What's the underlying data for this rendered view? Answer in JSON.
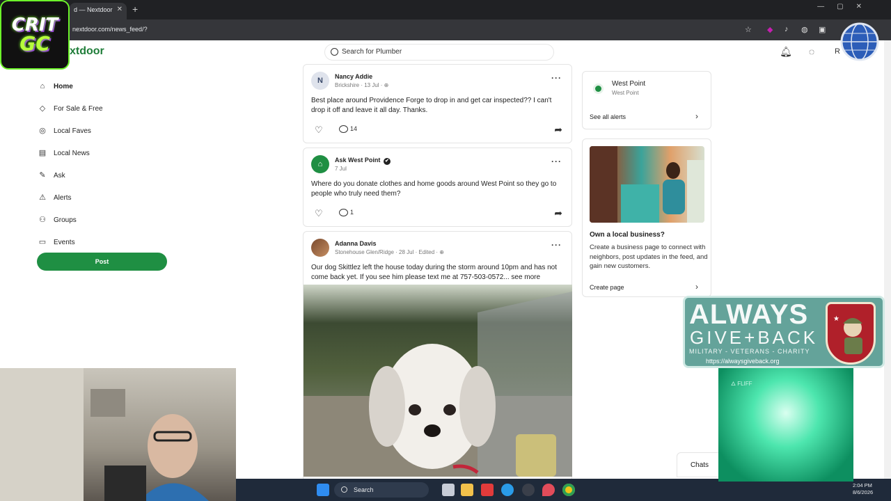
{
  "browser": {
    "tab_title": "d — Nextdoor",
    "tab_close": "✕",
    "new_tab": "+",
    "url": "nextdoor.com/news_feed/?"
  },
  "overlay": {
    "logo_line1": "CRIT",
    "logo_line2": "GC",
    "banner_big": "ALWAYS",
    "banner_small": "GIVE+BACK",
    "banner_sub": "MILITARY - VETERANS - CHARITY",
    "banner_url": "https://alwaysgiveback.org",
    "glow_label": "🜂 FLIFF"
  },
  "header": {
    "brand": "xtdoor",
    "search_placeholder": "Search for Plumber",
    "avatar_initial": "R"
  },
  "nav": {
    "items": [
      {
        "label": "Home",
        "icon": "home-icon",
        "glyph": "⌂"
      },
      {
        "label": "For Sale & Free",
        "icon": "tag-icon",
        "glyph": "◇"
      },
      {
        "label": "Local Faves",
        "icon": "badge-icon",
        "glyph": "◎"
      },
      {
        "label": "Local News",
        "icon": "newspaper-icon",
        "glyph": "▤"
      },
      {
        "label": "Ask",
        "icon": "ask-icon",
        "glyph": "✎"
      },
      {
        "label": "Alerts",
        "icon": "alert-icon",
        "glyph": "⚠"
      },
      {
        "label": "Groups",
        "icon": "groups-icon",
        "glyph": "⚇"
      },
      {
        "label": "Events",
        "icon": "calendar-icon",
        "glyph": "▭"
      }
    ],
    "post_label": "Post"
  },
  "feed": {
    "posts": [
      {
        "initial": "N",
        "author": "Nancy Addie",
        "meta": "Brickshire · 13 Jul · ⊕",
        "body": "Best place around Providence Forge to drop in and get car inspected?? I can't drop it off and leave it all day.  Thanks.",
        "comments": "14"
      },
      {
        "initial": "⌂",
        "author": "Ask West Point",
        "verified": "✔",
        "meta": "7 Jul",
        "body": "Where do you donate clothes and home goods around West Point so they go to people who truly need them?",
        "comments": "1"
      },
      {
        "initial": "",
        "author": "Adanna Davis",
        "meta": "Stonehouse Glen/Ridge · 28 Jul · Edited · ⊕",
        "body": "Our dog Skittlez left the house today during the storm around 10pm and has not come back yet. If you see him please text me at 757-503-0572...",
        "see_more": " see more"
      }
    ]
  },
  "right": {
    "alert_title": "West Point",
    "alert_sub": "West Point",
    "see_all": "See all alerts",
    "biz_heading": "Own a local business?",
    "biz_desc": "Create a business page to connect with neighbors, post updates in the feed, and gain new customers.",
    "create_page": "Create page",
    "chats": "Chats"
  },
  "taskbar": {
    "search": "Search",
    "time": "2:04 PM",
    "date": "8/6/2026"
  }
}
